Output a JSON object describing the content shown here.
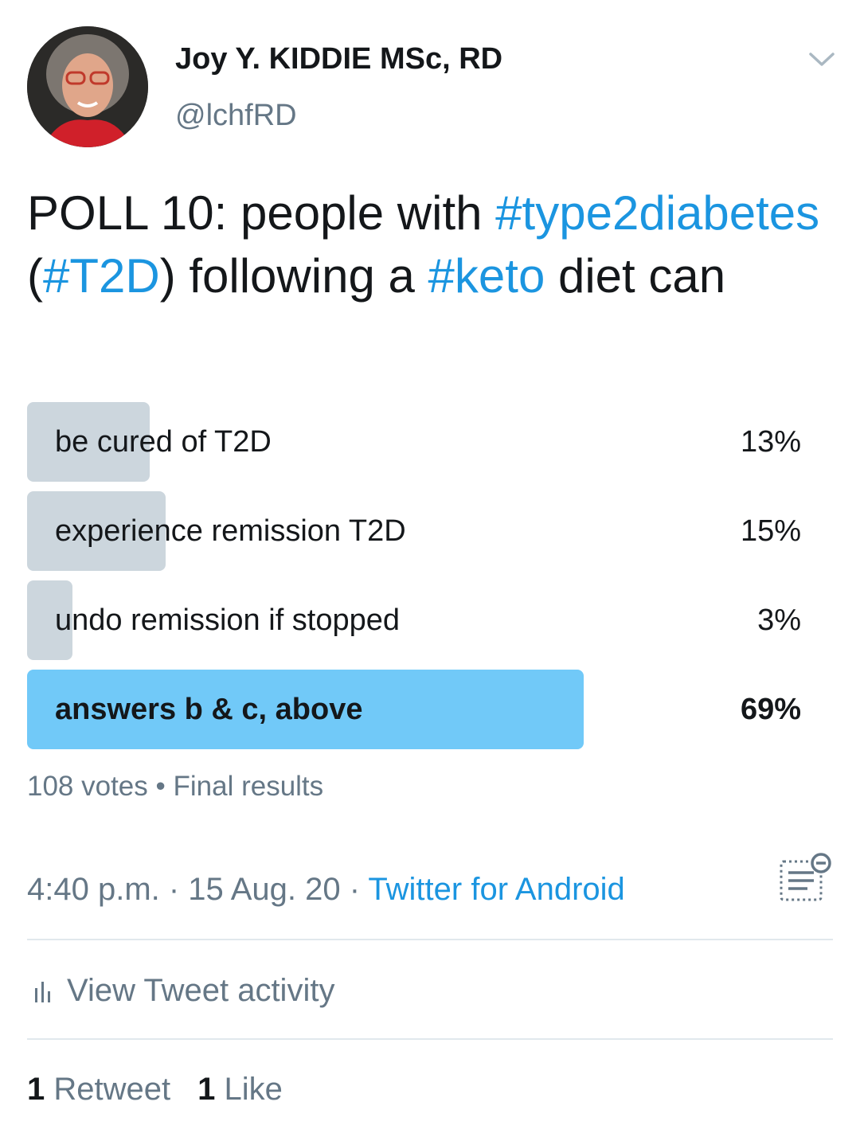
{
  "author": {
    "display_name": "Joy Y. KIDDIE MSc, RD",
    "handle": "@lchfRD",
    "avatar_icon": "user-avatar-photo"
  },
  "tweet": {
    "parts": [
      {
        "text": "POLL 10: people with ",
        "tag": false
      },
      {
        "text": "#type2diabetes",
        "tag": true
      },
      {
        "text": " (",
        "tag": false
      },
      {
        "text": "#T2D",
        "tag": true
      },
      {
        "text": ") following a ",
        "tag": false
      },
      {
        "text": "#keto",
        "tag": true
      },
      {
        "text": " diet can",
        "tag": false
      }
    ]
  },
  "poll": {
    "options": [
      {
        "label": "be cured of T2D",
        "percent_text": "13%",
        "percent": 13,
        "winner": false
      },
      {
        "label": "experience remission T2D",
        "percent_text": "15%",
        "percent": 15,
        "winner": false
      },
      {
        "label": "undo remission if stopped",
        "percent_text": "3%",
        "percent": 3,
        "winner": false
      },
      {
        "label": "answers b & c, above",
        "percent_text": "69%",
        "percent": 69,
        "winner": true
      }
    ],
    "votes": "108 votes",
    "separator": " • ",
    "status": "Final results"
  },
  "timestamp": {
    "text": "4:40 p.m. · 15 Aug. 20 · ",
    "source": "Twitter for Android"
  },
  "activity": {
    "label": "View Tweet activity",
    "icon": "bar-chart-icon"
  },
  "stats": {
    "retweet_count": "1",
    "retweet_label": "Retweet",
    "like_count": "1",
    "like_label": "Like"
  },
  "colors": {
    "link": "#1b95e0",
    "poll_bar": "#ccd6dd",
    "poll_bar_winner": "#71c9f8",
    "secondary_text": "#657786"
  }
}
